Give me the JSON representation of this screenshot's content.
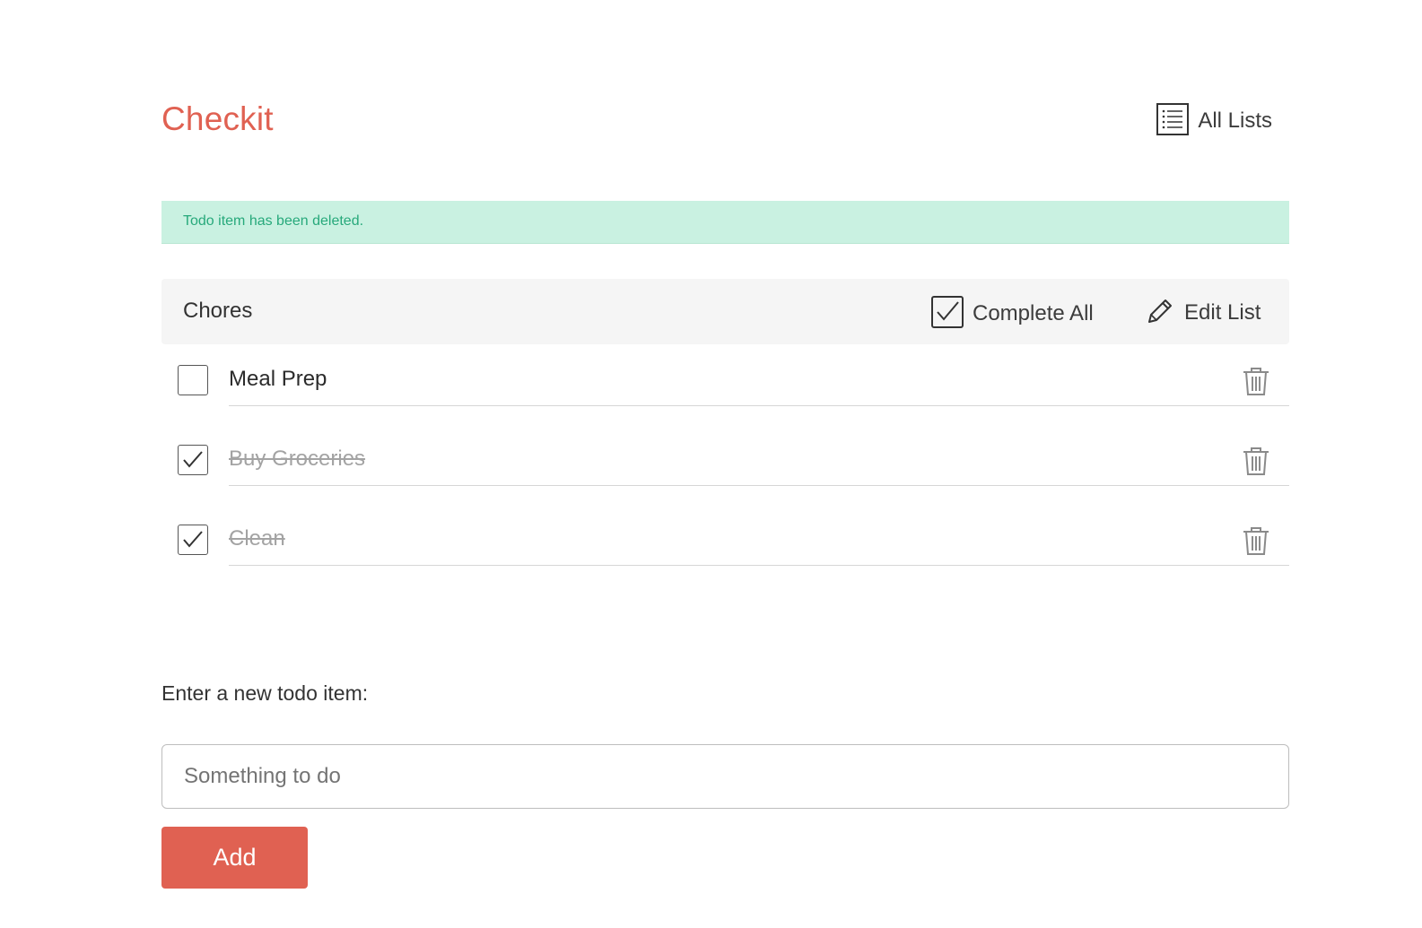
{
  "header": {
    "brand": "Checkit",
    "all_lists_label": "All Lists",
    "all_lists_icon": "list-icon"
  },
  "flash": {
    "message": "Todo item has been deleted."
  },
  "list": {
    "title": "Chores",
    "complete_all_label": "Complete All",
    "complete_all_icon": "checkbox-checked-icon",
    "edit_list_label": "Edit List",
    "edit_list_icon": "pencil-icon",
    "todos": [
      {
        "title": "Meal Prep",
        "completed": false,
        "delete_icon": "trash-icon"
      },
      {
        "title": "Buy Groceries",
        "completed": true,
        "delete_icon": "trash-icon"
      },
      {
        "title": "Clean",
        "completed": true,
        "delete_icon": "trash-icon"
      }
    ]
  },
  "new_todo": {
    "label": "Enter a new todo item:",
    "placeholder": "Something to do",
    "value": "",
    "add_label": "Add"
  },
  "colors": {
    "brand": "#e06152",
    "flash_bg": "#c9f1e1",
    "flash_text": "#27a97b",
    "list_header_bg": "#f5f5f5",
    "completed_text": "#a3a3a3"
  }
}
